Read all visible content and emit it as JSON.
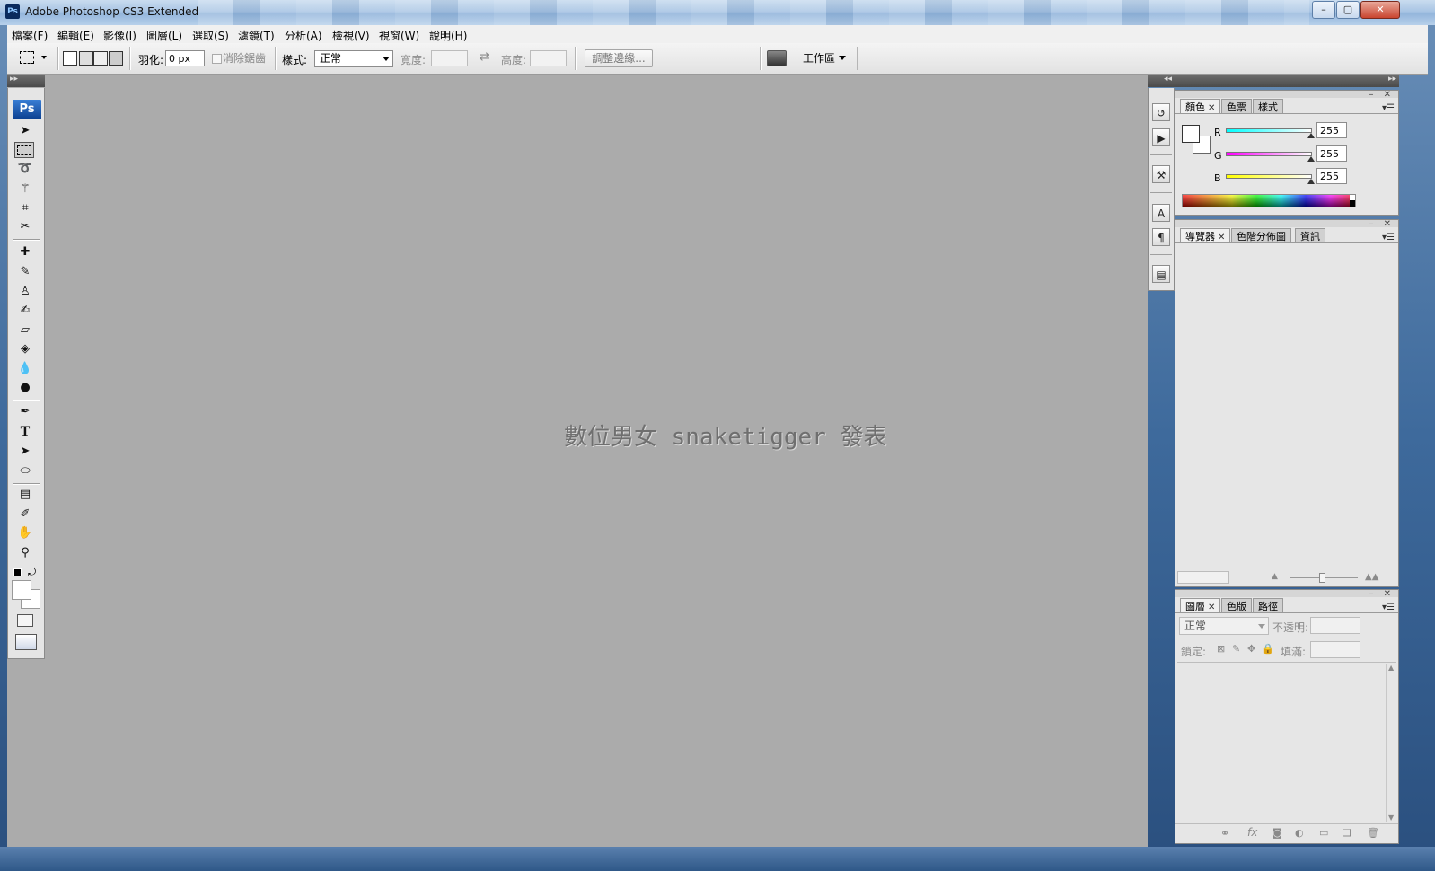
{
  "window": {
    "title": "Adobe Photoshop CS3 Extended",
    "app_icon": "Ps",
    "controls": {
      "minimize": "–",
      "maximize": "▢",
      "close": "✕"
    }
  },
  "menu": [
    "檔案(F)",
    "編輯(E)",
    "影像(I)",
    "圖層(L)",
    "選取(S)",
    "濾鏡(T)",
    "分析(A)",
    "檢視(V)",
    "視窗(W)",
    "說明(H)"
  ],
  "options": {
    "feather_label": "羽化:",
    "feather_value": "0 px",
    "antialias_label": "消除鋸齒",
    "style_label": "樣式:",
    "style_value": "正常",
    "width_label": "寬度:",
    "height_label": "高度:",
    "refine_edge_label": "調整邊緣...",
    "workspace_label": "工作區"
  },
  "canvas": {
    "watermark": "數位男女 snaketigger 發表",
    "background_color": "#ababab"
  },
  "toolbox": {
    "logo": "Ps"
  },
  "color_panel": {
    "tabs": [
      "顏色",
      "色票",
      "樣式"
    ],
    "channels": [
      {
        "name": "R",
        "value": "255"
      },
      {
        "name": "G",
        "value": "255"
      },
      {
        "name": "B",
        "value": "255"
      }
    ]
  },
  "navigator_panel": {
    "tabs": [
      "導覽器",
      "色階分佈圖",
      "資訊"
    ]
  },
  "layers_panel": {
    "tabs": [
      "圖層",
      "色版",
      "路徑"
    ],
    "blend_mode": "正常",
    "opacity_label": "不透明:",
    "lock_label": "鎖定:",
    "fill_label": "填滿:"
  },
  "colors": {
    "workspace": "#ababab",
    "panel": "#e6e6e6",
    "titlebar": "#a9c5e4"
  }
}
